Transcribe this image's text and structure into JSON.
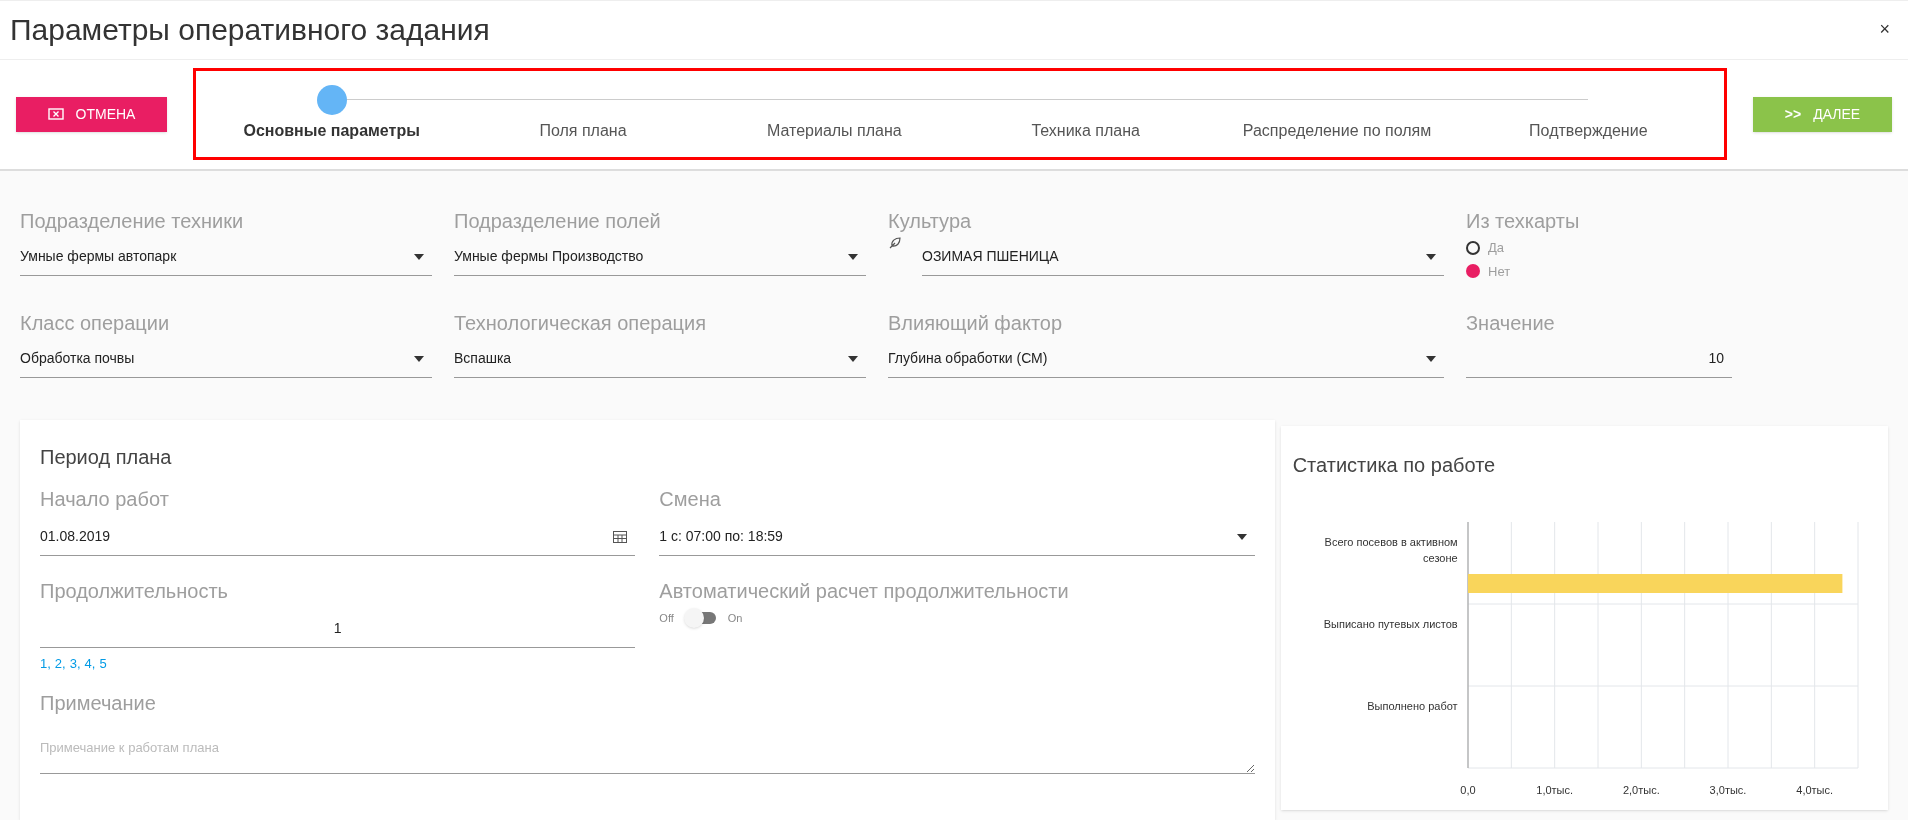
{
  "window": {
    "title": "Параметры оперативного задания",
    "close": "×"
  },
  "cancel_button": {
    "label": "ОТМЕНА"
  },
  "next_button": {
    "label": "ДАЛЕЕ",
    "icon_text": ">>"
  },
  "steps": [
    {
      "label": "Основные параметры",
      "selected": true
    },
    {
      "label": "Поля плана",
      "selected": false
    },
    {
      "label": "Материалы плана",
      "selected": false
    },
    {
      "label": "Техника плана",
      "selected": false
    },
    {
      "label": "Распределение по полям",
      "selected": false
    },
    {
      "label": "Подтверждение",
      "selected": false
    }
  ],
  "fields": [
    {
      "kind": "select",
      "label": "Подразделение техники",
      "value": "Умные фермы автопарк"
    },
    {
      "kind": "select",
      "label": "Подразделение полей",
      "value": "Умные фермы Производство"
    },
    {
      "kind": "select_icon",
      "label": "Культура",
      "value": "ОЗИМАЯ ПШЕНИЦА"
    },
    {
      "kind": "radio",
      "label": "Из техкарты",
      "options": [
        {
          "label": "Да",
          "selected": false
        },
        {
          "label": "Нет",
          "selected": true
        }
      ]
    },
    {
      "kind": "select",
      "label": "Класс операции",
      "value": "Обработка почвы"
    },
    {
      "kind": "select",
      "label": "Технологическая операция",
      "value": "Вспашка"
    },
    {
      "kind": "select",
      "label": "Влияющий фактор",
      "value": "Глубина обработки (СМ)"
    },
    {
      "kind": "number",
      "label": "Значение",
      "value": "10"
    }
  ],
  "period": {
    "title": "Период плана",
    "start": {
      "label": "Начало работ",
      "value": "01.08.2019"
    },
    "shift": {
      "label": "Смена",
      "value": "1 с: 07:00 по: 18:59"
    },
    "duration": {
      "label": "Продолжительность",
      "value": "1",
      "links": [
        "1",
        "2",
        "3",
        "4",
        "5"
      ],
      "separator": ","
    },
    "auto": {
      "label": "Автоматический расчет продолжительности",
      "off_label": "Off",
      "on_label": "On",
      "on": false
    },
    "note": {
      "label": "Примечание",
      "placeholder": "Примечание к работам плана"
    }
  },
  "stats": {
    "title": "Статистика по работе",
    "chart_data": {
      "type": "bar",
      "orientation": "horizontal",
      "categories": [
        "Всего посевов в активном сезоне",
        "Выписано путевых листов",
        "Выполнено работ"
      ],
      "series": [
        {
          "color": "#f9d55b",
          "values": [
            4.32,
            null,
            null
          ]
        }
      ],
      "xlim": [
        0,
        4.5
      ],
      "grid": true,
      "xticks": [
        {
          "value": 0,
          "label": "0,0"
        },
        {
          "value": 1,
          "label": "1,0тыс."
        },
        {
          "value": 2,
          "label": "2,0тыс."
        },
        {
          "value": 3,
          "label": "3,0тыс."
        },
        {
          "value": 4,
          "label": "4,0тыс."
        }
      ]
    }
  }
}
